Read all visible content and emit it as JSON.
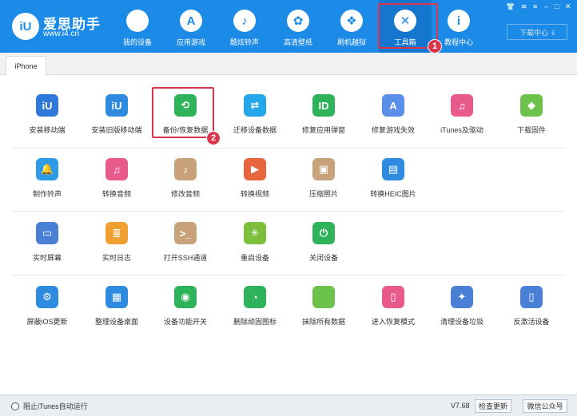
{
  "header": {
    "logo_text": "iU",
    "app_name": "爱思助手",
    "app_url": "www.i4.cn",
    "nav": [
      {
        "id": "my-device",
        "label": "我的设备",
        "icon": "apple-icon",
        "glyph": ""
      },
      {
        "id": "apps",
        "label": "应用游戏",
        "icon": "app-store-icon",
        "glyph": "A"
      },
      {
        "id": "ringtones",
        "label": "酷炫铃声",
        "icon": "bell-icon",
        "glyph": "♪"
      },
      {
        "id": "wallpapers",
        "label": "高清壁纸",
        "icon": "flower-icon",
        "glyph": "✿"
      },
      {
        "id": "jailbreak",
        "label": "刷机越狱",
        "icon": "dropbox-icon",
        "glyph": "❖"
      },
      {
        "id": "toolbox",
        "label": "工具箱",
        "icon": "tools-icon",
        "glyph": "✕"
      },
      {
        "id": "tutorials",
        "label": "教程中心",
        "icon": "info-icon",
        "glyph": "i"
      }
    ],
    "download_center": "下载中心",
    "window_controls": {
      "shirt": "👕",
      "wifi": "≋",
      "menu": "≡",
      "minimize": "–",
      "maximize": "□",
      "close": "✕"
    }
  },
  "markers": {
    "one": "1",
    "two": "2"
  },
  "tabs": {
    "active": "iPhone"
  },
  "tools": [
    {
      "label": "安装移动端",
      "icon": "iu-icon",
      "glyph": "iU",
      "color": "#2f77d9"
    },
    {
      "label": "安装旧版移动端",
      "icon": "iu-icon",
      "glyph": "iU",
      "color": "#2f8be0"
    },
    {
      "label": "备份/恢复数据",
      "icon": "backup-clock-icon",
      "glyph": "⟲",
      "color": "#2fb35a"
    },
    {
      "label": "迁移设备数据",
      "icon": "transfer-icon",
      "glyph": "⇄",
      "color": "#23a7e8"
    },
    {
      "label": "修复应用弹窗",
      "icon": "apple-id-icon",
      "glyph": "ID",
      "color": "#2fb35a"
    },
    {
      "label": "修复游戏失效",
      "icon": "app-store-icon",
      "glyph": "A",
      "color": "#5b8ee8"
    },
    {
      "label": "iTunes及驱动",
      "icon": "itunes-icon",
      "glyph": "♫",
      "color": "#e85a8c"
    },
    {
      "label": "下载固件",
      "icon": "cube-icon",
      "glyph": "◆",
      "color": "#6cc24a"
    },
    {
      "label": "制作铃声",
      "icon": "bell-icon",
      "glyph": "🔔",
      "color": "#2f9be8"
    },
    {
      "label": "转换音频",
      "icon": "music-icon",
      "glyph": "♫",
      "color": "#e85a8c"
    },
    {
      "label": "修改音频",
      "icon": "music-edit-icon",
      "glyph": "♪",
      "color": "#c8a27a"
    },
    {
      "label": "转换视频",
      "icon": "play-icon",
      "glyph": "▶",
      "color": "#e8663e"
    },
    {
      "label": "压缩照片",
      "icon": "photo-icon",
      "glyph": "▣",
      "color": "#c8a27a"
    },
    {
      "label": "转换HEIC图片",
      "icon": "heic-photo-icon",
      "glyph": "▤",
      "color": "#2f8be0"
    },
    {
      "label": "实时屏幕",
      "icon": "monitor-icon",
      "glyph": "▭",
      "color": "#4a7fd6"
    },
    {
      "label": "实时日志",
      "icon": "document-icon",
      "glyph": "≣",
      "color": "#f0a030"
    },
    {
      "label": "打开SSH通道",
      "icon": "terminal-icon",
      "glyph": ">_",
      "color": "#c8a27a"
    },
    {
      "label": "重启设备",
      "icon": "restart-icon",
      "glyph": "✳",
      "color": "#7cbf3a"
    },
    {
      "label": "关闭设备",
      "icon": "power-icon",
      "glyph": "⏻",
      "color": "#2fb35a"
    },
    {
      "label": "屏蔽iOS更新",
      "icon": "gear-icon",
      "glyph": "⚙",
      "color": "#2f8be0"
    },
    {
      "label": "整理设备桌面",
      "icon": "grid-icon",
      "glyph": "▦",
      "color": "#2f8be0"
    },
    {
      "label": "设备功能开关",
      "icon": "toggle-icon",
      "glyph": "◉",
      "color": "#2fb35a"
    },
    {
      "label": "删除顽固图标",
      "icon": "pie-icon",
      "glyph": "◔",
      "color": "#2fb35a"
    },
    {
      "label": "抹除所有数据",
      "icon": "apple-erase-icon",
      "glyph": "",
      "color": "#6cc24a"
    },
    {
      "label": "进入恢复模式",
      "icon": "phone-icon",
      "glyph": "▯",
      "color": "#e85a8c"
    },
    {
      "label": "清理设备垃圾",
      "icon": "broom-icon",
      "glyph": "✦",
      "color": "#4a7fd6"
    },
    {
      "label": "反激活设备",
      "icon": "phone-deactivate-icon",
      "glyph": "▯",
      "color": "#4a7fd6"
    }
  ],
  "status": {
    "itunes_block": "阻止iTunes自动运行",
    "version": "V7.68",
    "check_update": "检查更新",
    "wechat": "微信公众号"
  }
}
